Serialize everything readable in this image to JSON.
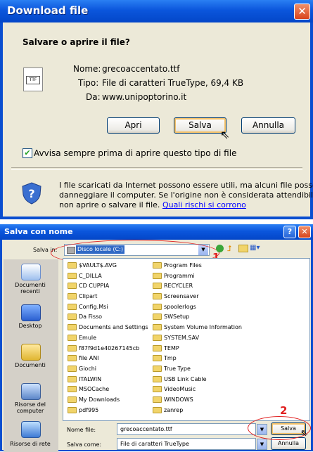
{
  "download": {
    "title": "Download file",
    "question": "Salvare o aprire il file?",
    "name_label": "Nome:",
    "name_value": "grecoaccentato.ttf",
    "type_label": "Tipo:",
    "type_value": "File di caratteri TrueType, 69,4 KB",
    "from_label": "Da:",
    "from_value": "www.unipoptorino.it",
    "btn_open": "Apri",
    "btn_save": "Salva",
    "btn_cancel": "Annulla",
    "checkbox_label": "Avvisa sempre prima di aprire questo tipo di file",
    "warning_text_1": "I file scaricati da Internet possono essere utili, ma alcuni file possono",
    "warning_text_2": "danneggiare il computer. Se l'origine non è considerata attendibile,",
    "warning_text_3": "non aprire o salvare il file.",
    "warning_link": "Quali rischi si corrono",
    "file_icon_text": "TTF"
  },
  "saveas": {
    "title": "Salva con nome",
    "help_glyph": "?",
    "save_in_label": "Salva in:",
    "save_in_value": "Disco locale (C:)",
    "annotation_1": "1",
    "annotation_2": "2",
    "places": [
      {
        "label": "Documenti recenti"
      },
      {
        "label": "Desktop"
      },
      {
        "label": "Documenti"
      },
      {
        "label": "Risorse del computer"
      },
      {
        "label": "Risorse di rete"
      }
    ],
    "folders_col1": [
      "$VAULT$.AVG",
      "C_DILLA",
      "CD CUPPIA",
      "Clipart",
      "Config.Msi",
      "Da Fisso",
      "Documents and Settings",
      "Emule",
      "f87f9d1e40267145cb",
      "file ANI",
      "Giochi",
      "ITALWIN",
      "MSOCache",
      "My Downloads",
      "pdf995"
    ],
    "folders_col2": [
      "Program Files",
      "Programmi",
      "RECYCLER",
      "Screensaver",
      "spoolerlogs",
      "SWSetup",
      "System Volume Information",
      "SYSTEM.SAV",
      "TEMP",
      "Tmp",
      "True Type",
      "USB Link Cable",
      "VideoMusic",
      "WINDOWS",
      "zanrep"
    ],
    "filename_label": "Nome file:",
    "filename_value": "grecoaccentato.ttf",
    "savetype_label": "Salva come:",
    "savetype_value": "File di caratteri TrueType",
    "btn_save": "Salva",
    "btn_cancel": "Annulla"
  },
  "colors": {
    "titlebar": "#0b56dc",
    "dialog_bg": "#ece9d8",
    "annotation": "#e02020"
  }
}
